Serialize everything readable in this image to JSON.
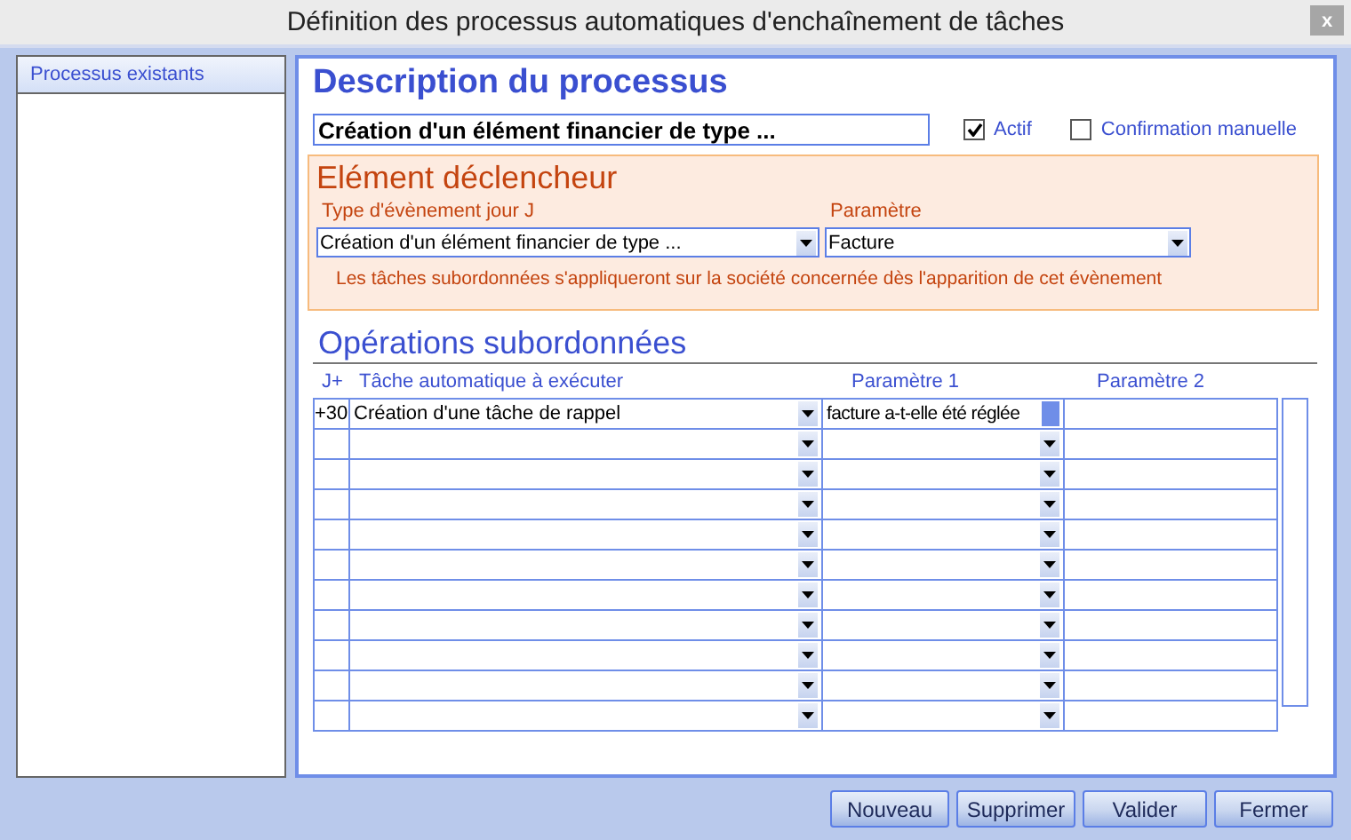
{
  "window": {
    "title": "Définition des processus automatiques d'enchaînement de tâches",
    "close": "x"
  },
  "sidebar": {
    "title": "Processus existants"
  },
  "description": {
    "title": "Description du processus",
    "name": "Création d'un élément financier de type ...",
    "options": [
      {
        "label": "Actif",
        "checked": true
      },
      {
        "label": "Confirmation manuelle",
        "checked": false
      }
    ]
  },
  "trigger": {
    "title": "Elément déclencheur",
    "event_label": "Type d'évènement jour J",
    "event_value": "Création d'un élément financier de type ...",
    "parameter_label": "Paramètre",
    "parameter_value": "Facture",
    "message": "Les tâches subordonnées s'appliqueront sur la société concernée dès l'apparition de cet évènement"
  },
  "operations": {
    "title": "Opérations subordonnées",
    "columns": [
      "J+",
      "Tâche automatique à exécuter",
      "Paramètre 1",
      "Paramètre 2"
    ],
    "rows": [
      {
        "day": "+30",
        "task": "Création d'une tâche de rappel",
        "parameter_1": "facture a-t-elle été réglée",
        "focused": true
      },
      {
        "focused": false
      },
      {
        "focused": false
      },
      {
        "focused": false
      },
      {
        "focused": false
      },
      {
        "focused": false
      },
      {
        "focused": false
      },
      {
        "focused": false
      },
      {
        "focused": false
      },
      {
        "focused": false
      },
      {
        "focused": false
      }
    ]
  },
  "buttons": [
    "Nouveau",
    "Supprimer",
    "Valider",
    "Fermer"
  ]
}
